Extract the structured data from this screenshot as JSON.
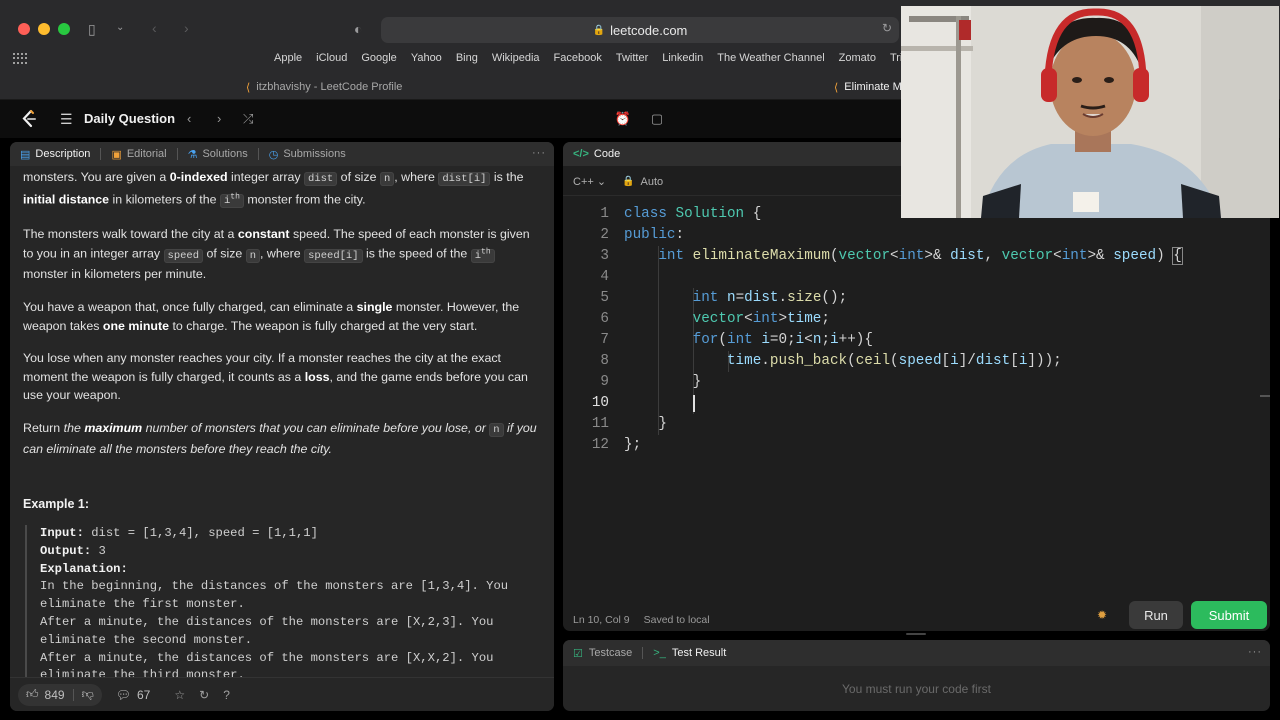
{
  "browser": {
    "url": "leetcode.com",
    "favorites": [
      "Apple",
      "iCloud",
      "Google",
      "Yahoo",
      "Bing",
      "Wikipedia",
      "Facebook",
      "Twitter",
      "Linkedin",
      "The Weather Channel",
      "Zomato",
      "TripAdv"
    ],
    "tabs": [
      {
        "label": "itzbhavishy - LeetCode Profile",
        "active": false
      },
      {
        "label": "Eliminate M",
        "active": true
      }
    ]
  },
  "nav": {
    "daily_label": "Daily Question"
  },
  "left": {
    "tabs": [
      "Description",
      "Editorial",
      "Solutions",
      "Submissions"
    ],
    "paragraphs": {
      "p1": {
        "a": "monsters. You are given a ",
        "b": "0-indexed",
        "c": " integer array ",
        "d": "dist",
        "e": " of size ",
        "f": "n",
        "g": ", where ",
        "h": "dist[i]",
        "i": " is the ",
        "j": "initial distance",
        "k": " in kilometers of the ",
        "l": "i",
        "m": "th",
        "n": " monster from the city."
      },
      "p2": {
        "a": "The monsters walk toward the city at a ",
        "b": "constant",
        "c": " speed. The speed of each monster is given to you in an integer array ",
        "d": "speed",
        "e": " of size ",
        "f": "n",
        "g": ", where ",
        "h": "speed[i]",
        "i": " is the speed of the ",
        "j": "i",
        "k": "th",
        "l": " monster in kilometers per minute."
      },
      "p3": {
        "a": "You have a weapon that, once fully charged, can eliminate a ",
        "b": "single",
        "c": " monster. However, the weapon takes ",
        "d": "one minute",
        "e": " to charge. The weapon is fully charged at the very start."
      },
      "p4": {
        "a": "You lose when any monster reaches your city. If a monster reaches the city at the exact moment the weapon is fully charged, it counts as a ",
        "b": "loss",
        "c": ", and the game ends before you can use your weapon."
      },
      "p5": {
        "a": "Return ",
        "b": "the ",
        "c": "maximum",
        "d": " number of monsters that you can eliminate before you lose, or ",
        "e": "n",
        "f": " if you can eliminate all the monsters before they reach the city."
      }
    },
    "example_title": "Example 1:",
    "example": {
      "input_label": "Input:",
      "input_value": " dist = [1,3,4], speed = [1,1,1]",
      "output_label": "Output:",
      "output_value": " 3",
      "explanation_label": "Explanation:",
      "lines": [
        "In the beginning, the distances of the monsters are [1,3,4]. You",
        "eliminate the first monster.",
        "After a minute, the distances of the monsters are [X,2,3]. You",
        "eliminate the second monster.",
        "After a minute, the distances of the monsters are [X,X,2]. You",
        "eliminate the third monster."
      ]
    },
    "footer": {
      "likes": "849",
      "comments": "67"
    }
  },
  "code": {
    "title": "Code",
    "language": "C++",
    "mode": "Auto",
    "line_numbers": [
      "1",
      "2",
      "3",
      "4",
      "5",
      "6",
      "7",
      "8",
      "9",
      "10",
      "11",
      "12"
    ],
    "status_pos": "Ln 10, Col 9",
    "status_saved": "Saved to local",
    "run_label": "Run",
    "submit_label": "Submit"
  },
  "test": {
    "tab_testcase": "Testcase",
    "tab_result": "Test Result",
    "empty_message": "You must run your code first"
  },
  "colors": {
    "submit": "#2cbb5d",
    "accent_green": "#36b37e",
    "keyword": "#569cd6"
  }
}
